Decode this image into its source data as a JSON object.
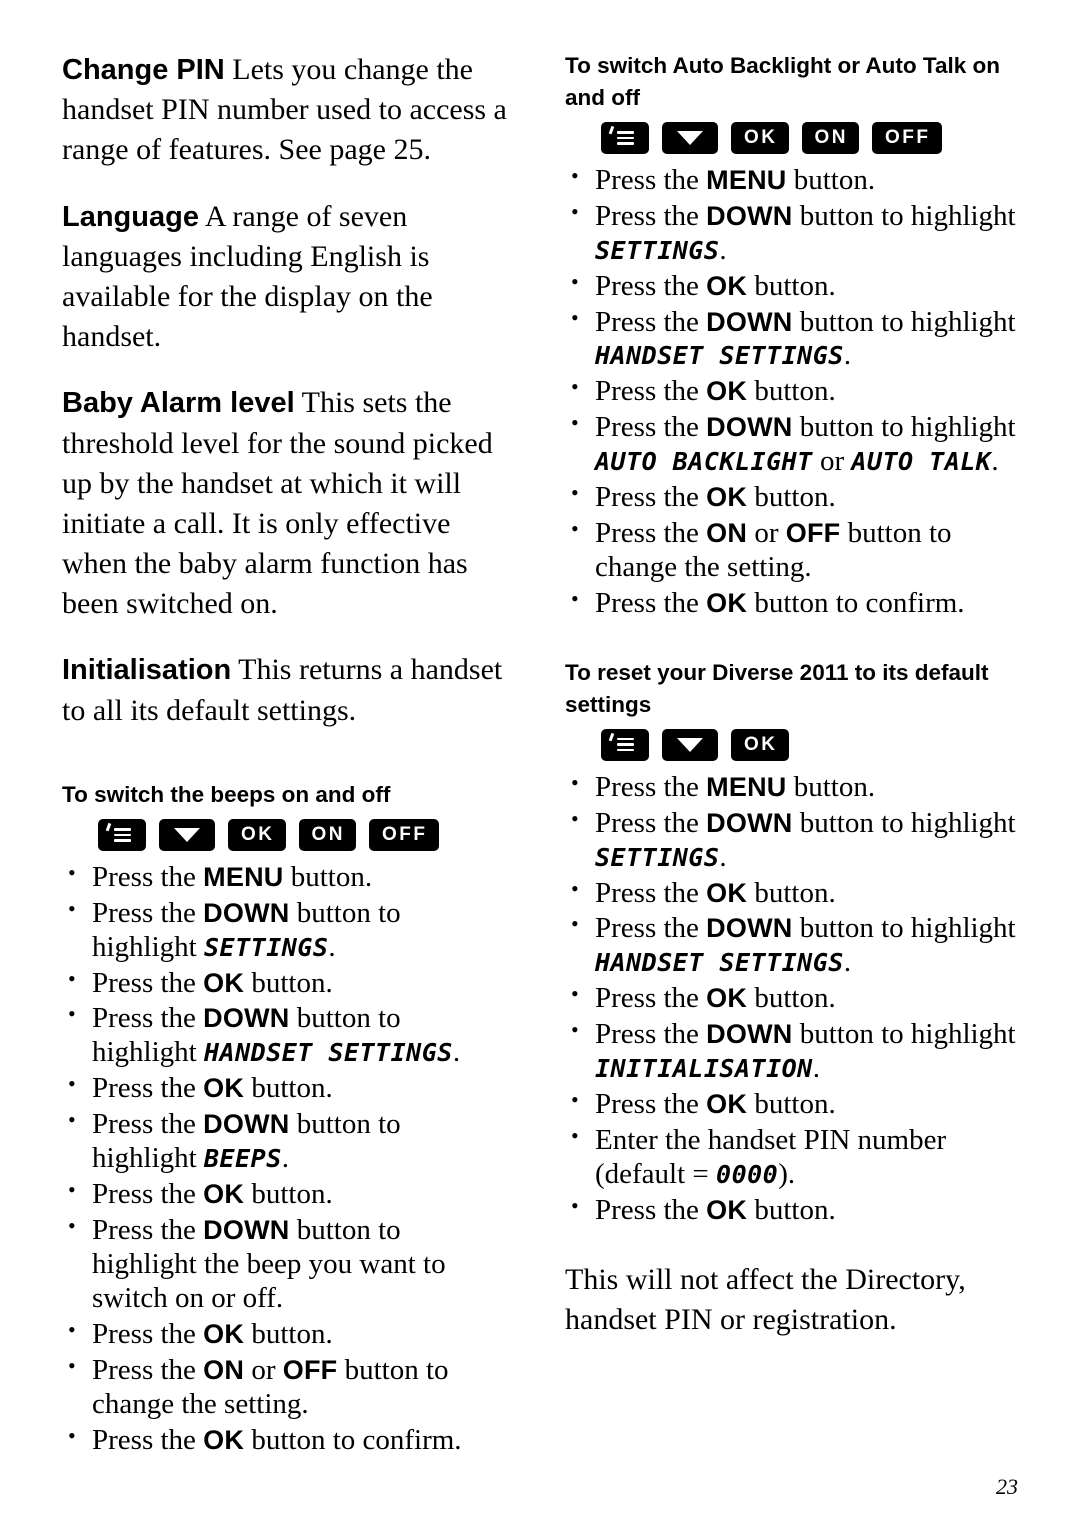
{
  "page_number": "23",
  "left_column": {
    "paragraphs": [
      {
        "lead": "Change PIN",
        "text": " Lets you change the handset PIN number used to access a range of features. See page 25."
      },
      {
        "lead": "Language",
        "text": " A range of seven languages including English is available for the display on the handset."
      },
      {
        "lead": "Baby Alarm level",
        "text": " This sets the threshold level for the sound picked up by the handset at which it will initiate a call. It is only effective when the baby alarm function has been switched on."
      },
      {
        "lead": "Initialisation",
        "text": " This returns a handset to all its default settings."
      }
    ],
    "section": {
      "heading": "To switch the beeps on and off",
      "keys": [
        "menu-key",
        "down-key",
        "OK",
        "ON",
        "OFF"
      ],
      "steps": [
        {
          "pre": "Press the ",
          "key": "MENU",
          "post": " button."
        },
        {
          "pre": "Press the ",
          "key": "DOWN",
          "post": " button to highlight ",
          "lcd": "SETTINGS",
          "tail": "."
        },
        {
          "pre": "Press the ",
          "key": "OK",
          "post": " button."
        },
        {
          "pre": "Press the ",
          "key": "DOWN",
          "post": " button to highlight ",
          "lcd": "HANDSET SETTINGS",
          "tail": "."
        },
        {
          "pre": "Press the ",
          "key": "OK",
          "post": " button."
        },
        {
          "pre": "Press the ",
          "key": "DOWN",
          "post": " button to highlight ",
          "lcd": "BEEPS",
          "tail": "."
        },
        {
          "pre": "Press the ",
          "key": "OK",
          "post": " button."
        },
        {
          "pre": "Press the ",
          "key": "DOWN",
          "post": " button to highlight the beep you want to switch on or off."
        },
        {
          "pre": "Press the ",
          "key": "OK",
          "post": " button."
        },
        {
          "pre": "Press the ",
          "key": "ON",
          "mid": " or ",
          "key2": "OFF",
          "post": " button to change the setting."
        },
        {
          "pre": "Press the ",
          "key": "OK",
          "post": " button to confirm."
        }
      ]
    }
  },
  "right_column": {
    "section_one": {
      "heading": "To switch Auto Backlight or Auto Talk on and off",
      "keys": [
        "menu-key",
        "down-key",
        "OK",
        "ON",
        "OFF"
      ],
      "steps": [
        {
          "pre": "Press the ",
          "key": "MENU",
          "post": " button."
        },
        {
          "pre": "Press the ",
          "key": "DOWN",
          "post": " button to highlight ",
          "lcd": "SETTINGS",
          "tail": "."
        },
        {
          "pre": "Press the ",
          "key": "OK",
          "post": " button."
        },
        {
          "pre": "Press the ",
          "key": "DOWN",
          "post": " button to highlight ",
          "lcd": "HANDSET SETTINGS",
          "tail": "."
        },
        {
          "pre": "Press the ",
          "key": "OK",
          "post": " button."
        },
        {
          "pre": "Press the ",
          "key": "DOWN",
          "post": " button to highlight ",
          "lcd": "AUTO BACKLIGHT",
          "mid2": " or ",
          "lcd2": "AUTO TALK",
          "tail": "."
        },
        {
          "pre": "Press the ",
          "key": "OK",
          "post": " button."
        },
        {
          "pre": "Press the ",
          "key": "ON",
          "mid": " or ",
          "key2": "OFF",
          "post": " button to change the setting."
        },
        {
          "pre": "Press the ",
          "key": "OK",
          "post": " button to confirm."
        }
      ]
    },
    "section_two": {
      "heading": "To reset your Diverse 2011 to its default settings",
      "keys": [
        "menu-key",
        "down-key",
        "OK"
      ],
      "steps": [
        {
          "pre": "Press the ",
          "key": "MENU",
          "post": " button."
        },
        {
          "pre": "Press the ",
          "key": "DOWN",
          "post": " button to highlight ",
          "lcd": "SETTINGS",
          "tail": "."
        },
        {
          "pre": "Press the ",
          "key": "OK",
          "post": " button."
        },
        {
          "pre": "Press the ",
          "key": "DOWN",
          "post": " button to highlight ",
          "lcd": "HANDSET SETTINGS",
          "tail": "."
        },
        {
          "pre": "Press the ",
          "key": "OK",
          "post": " button."
        },
        {
          "pre": "Press the ",
          "key": "DOWN",
          "post": " button to highlight ",
          "lcd": "INITIALISATION",
          "tail": "."
        },
        {
          "pre": "Press the ",
          "key": "OK",
          "post": " button."
        },
        {
          "pre": "Enter the handset PIN number (default = ",
          "lcd": "0000",
          "tail": ")."
        },
        {
          "pre": "Press the ",
          "key": "OK",
          "post": " button."
        }
      ],
      "closing": "This will not affect the Directory, handset PIN or registration."
    }
  },
  "key_labels": {
    "ok": "OK",
    "on": "ON",
    "off": "OFF"
  }
}
